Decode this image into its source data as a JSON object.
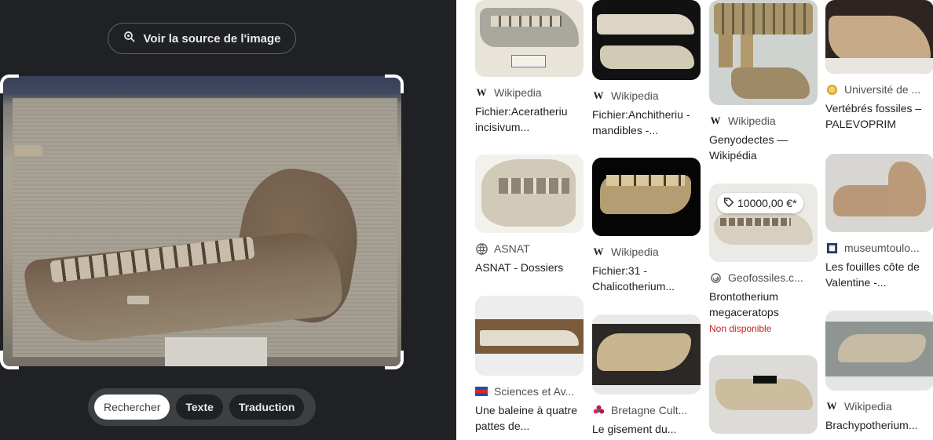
{
  "viewer": {
    "source_button_label": "Voir la source de l'image",
    "modes": [
      {
        "label": "Rechercher",
        "active": true
      },
      {
        "label": "Texte",
        "active": false
      },
      {
        "label": "Traduction",
        "active": false
      }
    ]
  },
  "results": {
    "columns": [
      [
        {
          "source": "Wikipedia",
          "source_icon": "wikipedia-icon",
          "title": "Fichier:Aceratheriu incisivum..."
        },
        {
          "source": "ASNAT",
          "source_icon": "globe-icon",
          "title": "ASNAT - Dossiers"
        },
        {
          "source": "Sciences et Av...",
          "source_icon": "flag-icon",
          "title": "Une baleine à quatre pattes de..."
        }
      ],
      [
        {
          "source": "Wikipedia",
          "source_icon": "wikipedia-icon",
          "title": "Fichier:Anchitheriu - mandibles -..."
        },
        {
          "source": "Wikipedia",
          "source_icon": "wikipedia-icon",
          "title": "Fichier:31 - Chalicotherium..."
        },
        {
          "source": "Bretagne Cult...",
          "source_icon": "flower-icon",
          "title": "Le gisement du..."
        }
      ],
      [
        {
          "source": "Wikipedia",
          "source_icon": "wikipedia-icon",
          "title": "Genyodectes — Wikipédia"
        },
        {
          "source": "Geofossiles.c...",
          "source_icon": "ammonite-icon",
          "title": "Brontotherium megaceratops",
          "price": "10000,00 €*",
          "availability": "Non disponible"
        }
      ],
      [
        {
          "source": "Université de ...",
          "source_icon": "university-icon",
          "title": "Vertébrés fossiles – PALEVOPRIM"
        },
        {
          "source": "museumtoulo...",
          "source_icon": "museum-icon",
          "title": "Les fouilles côte de Valentine -..."
        },
        {
          "source": "Wikipedia",
          "source_icon": "wikipedia-icon",
          "title": "Brachypotherium..."
        }
      ]
    ]
  },
  "colors": {
    "panel_bg": "#202124",
    "chip_bg": "#3c4043",
    "sold_out": "#c5221f"
  }
}
